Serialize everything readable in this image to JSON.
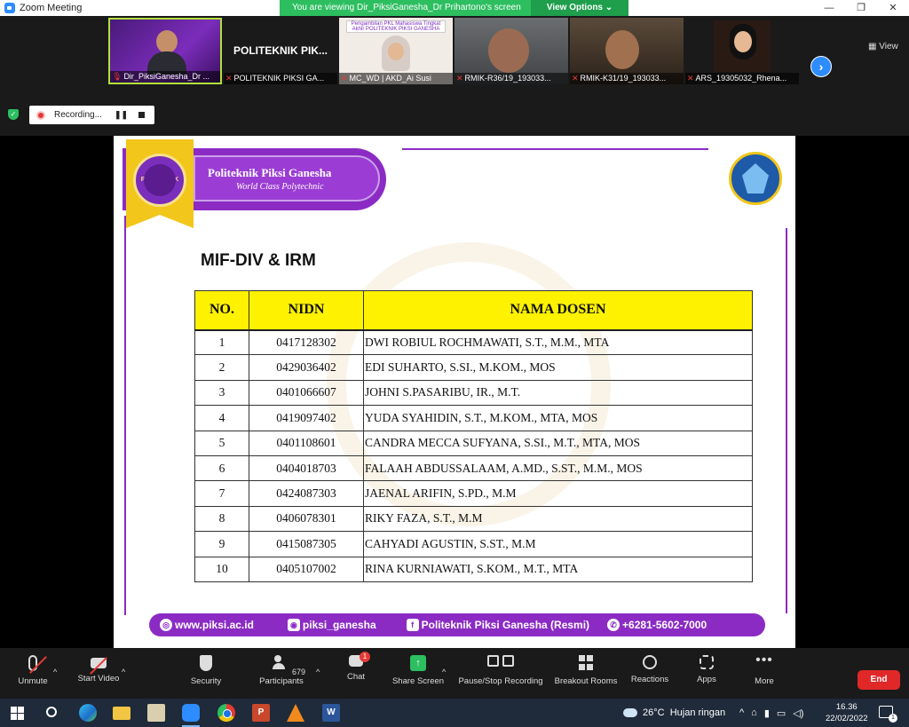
{
  "window": {
    "title": "Zoom Meeting",
    "controls": [
      "—",
      "❐",
      "✕"
    ]
  },
  "viewing_banner": {
    "message": "You are viewing Dir_PiksiGanesha_Dr Prihartono's screen",
    "options_label": "View Options ⌄"
  },
  "gallery": {
    "tiles": [
      {
        "label": "Dir_PiksiGanesha_Dr ..."
      },
      {
        "label": "POLITEKNIK PIKSI GA...",
        "big_name": "POLITEKNIK PIK..."
      },
      {
        "label": "MC_WD | AKD_Ai Susi",
        "banner": "Pengambilan PKL Mahasiswa Tingkat Akhir POLITEKNIK PIKSI GANESHA"
      },
      {
        "label": "RMIK-R36/19_193033..."
      },
      {
        "label": "RMIK-K31/19_193033..."
      },
      {
        "label": "ARS_19305032_Rhena..."
      }
    ],
    "next_label": "›",
    "view_label": "View"
  },
  "recording": {
    "label": "Recording...",
    "pause_icon": "pause-icon",
    "stop_icon": "stop-icon"
  },
  "slide": {
    "institution": "Politeknik Piksi Ganesha",
    "tagline": "World Class Polytechnic",
    "seal_text": "POLITEKNIK",
    "title": "MIF-DIV & IRM",
    "table": {
      "headers": [
        "NO.",
        "NIDN",
        "NAMA DOSEN"
      ],
      "rows": [
        {
          "no": "1",
          "nidn": "0417128302",
          "nama": "DWI ROBIUL ROCHMAWATI, S.T., M.M., MTA"
        },
        {
          "no": "2",
          "nidn": "0429036402",
          "nama": "EDI SUHARTO, S.SI., M.KOM., MOS"
        },
        {
          "no": "3",
          "nidn": "0401066607",
          "nama": "JOHNI S.PASARIBU, IR., M.T."
        },
        {
          "no": "4",
          "nidn": "0419097402",
          "nama": "YUDA SYAHIDIN, S.T., M.KOM., MTA, MOS"
        },
        {
          "no": "5",
          "nidn": "0401108601",
          "nama": "CANDRA MECCA SUFYANA, S.SI., M.T., MTA, MOS"
        },
        {
          "no": "6",
          "nidn": "0404018703",
          "nama": "FALAAH ABDUSSALAAM,  A.MD., S.ST., M.M., MOS"
        },
        {
          "no": "7",
          "nidn": "0424087303",
          "nama": "JAENAL ARIFIN, S.PD., M.M"
        },
        {
          "no": "8",
          "nidn": "0406078301",
          "nama": "RIKY FAZA, S.T., M.M"
        },
        {
          "no": "9",
          "nidn": "0415087305",
          "nama": "CAHYADI AGUSTIN, S.ST., M.M"
        },
        {
          "no": "10",
          "nidn": "0405107002",
          "nama": "RINA KURNIAWATI, S.KOM., M.T., MTA"
        }
      ]
    },
    "footer": {
      "website": "www.piksi.ac.id",
      "instagram": "piksi_ganesha",
      "facebook": "Politeknik Piksi Ganesha (Resmi)",
      "whatsapp": "+6281-5602-7000"
    },
    "colors": {
      "purple": "#8b2bc4",
      "yellow": "#fff200",
      "gold": "#f2c61a"
    }
  },
  "toolbar": {
    "unmute": "Unmute",
    "start_video": "Start Video",
    "security": "Security",
    "participants": "Participants",
    "participant_count": "679",
    "chat": "Chat",
    "chat_badge": "1",
    "share_screen": "Share Screen",
    "pause_stop_recording": "Pause/Stop Recording",
    "breakout_rooms": "Breakout Rooms",
    "reactions": "Reactions",
    "apps": "Apps",
    "more": "More",
    "more_dots": "•••",
    "end": "End"
  },
  "taskbar": {
    "temperature": "26°C",
    "weather": "Hujan ringan",
    "time": "16.36",
    "date": "22/02/2022",
    "notification_count": "1",
    "ppt_letter": "P",
    "word_letter": "W"
  }
}
